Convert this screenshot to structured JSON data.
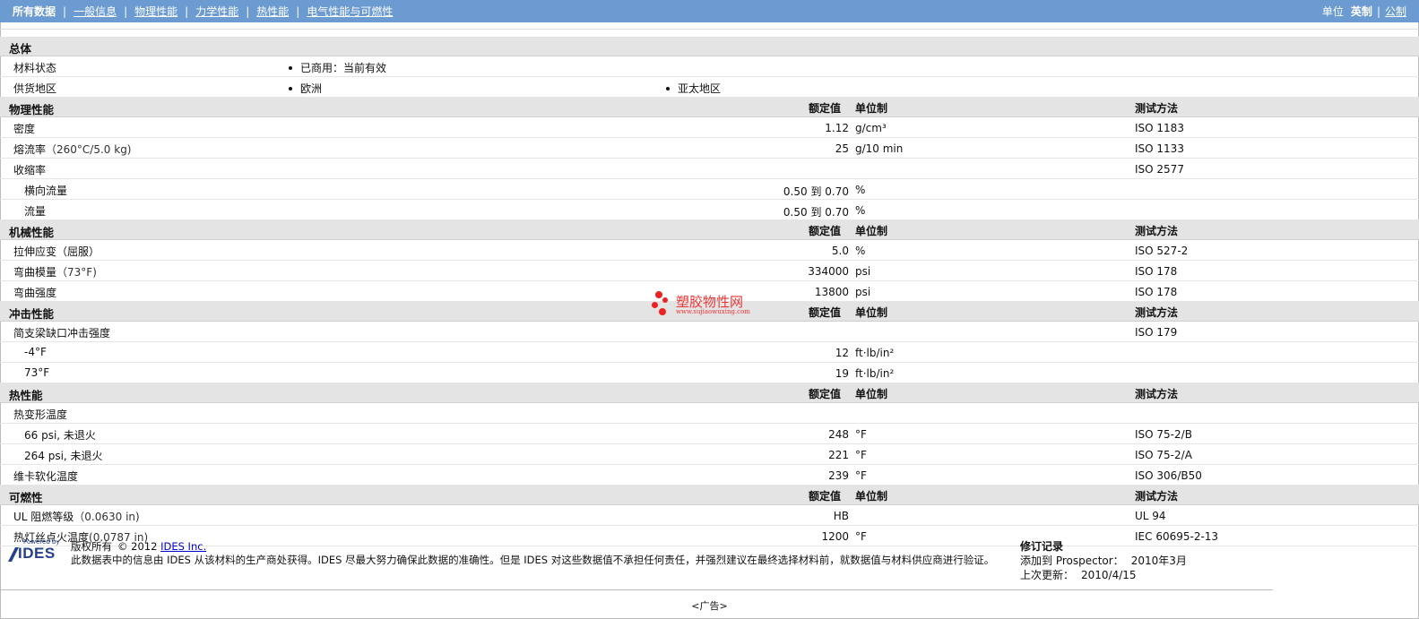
{
  "nav": {
    "tabs": [
      "所有数据",
      "一般信息",
      "物理性能",
      "力学性能",
      "热性能",
      "电气性能与可燃性"
    ],
    "units_label": "单位",
    "unit_english": "英制",
    "unit_metric": "公制"
  },
  "general": {
    "title": "总体",
    "material_status_label": "材料状态",
    "material_status_value": "已商用：当前有效",
    "availability_label": "供货地区",
    "availability_values": [
      "欧洲",
      "亚太地区"
    ]
  },
  "headers": {
    "nominal": "额定值",
    "unit": "单位制",
    "test": "测试方法"
  },
  "sections": [
    {
      "title": "物理性能",
      "rows": [
        {
          "name": "密度",
          "cond": "",
          "value": "1.12",
          "unit": "g/cm³",
          "test": "ISO 1183",
          "sub": false
        },
        {
          "name": "熔流率",
          "cond": "（260°C/5.0 kg)",
          "value": "25",
          "unit": "g/10 min",
          "test": "ISO 1133",
          "sub": false
        },
        {
          "name": "收缩率",
          "cond": "",
          "value": "",
          "unit": "",
          "test": "ISO 2577",
          "sub": false
        },
        {
          "name": "横向流量",
          "cond": "",
          "value": "0.50 到  0.70",
          "unit": "%",
          "test": "",
          "sub": true
        },
        {
          "name": "流量",
          "cond": "",
          "value": "0.50 到  0.70",
          "unit": "%",
          "test": "",
          "sub": true
        }
      ]
    },
    {
      "title": "机械性能",
      "rows": [
        {
          "name": "拉伸应变（屈服）",
          "cond": "",
          "value": "5.0",
          "unit": "%",
          "test": "ISO 527-2",
          "sub": false
        },
        {
          "name": "弯曲模量",
          "cond": "（73°F)",
          "value": "334000",
          "unit": "psi",
          "test": "ISO 178",
          "sub": false
        },
        {
          "name": "弯曲强度",
          "cond": "",
          "value": "13800",
          "unit": "psi",
          "test": "ISO 178",
          "sub": false
        }
      ]
    },
    {
      "title": "冲击性能",
      "rows": [
        {
          "name": "简支梁缺口冲击强度",
          "cond": "",
          "value": "",
          "unit": "",
          "test": "ISO 179",
          "sub": false
        },
        {
          "name": "-4°F",
          "cond": "",
          "value": "12",
          "unit": "ft·lb/in²",
          "test": "",
          "sub": true
        },
        {
          "name": "73°F",
          "cond": "",
          "value": "19",
          "unit": "ft·lb/in²",
          "test": "",
          "sub": true
        }
      ]
    },
    {
      "title": "热性能",
      "rows": [
        {
          "name": "热变形温度",
          "cond": "",
          "value": "",
          "unit": "",
          "test": "",
          "sub": false
        },
        {
          "name": "66 psi, 未退火",
          "cond": "",
          "value": "248",
          "unit": "°F",
          "test": "ISO 75-2/B",
          "sub": true
        },
        {
          "name": "264 psi, 未退火",
          "cond": "",
          "value": "221",
          "unit": "°F",
          "test": "ISO 75-2/A",
          "sub": true
        },
        {
          "name": "维卡软化温度",
          "cond": "",
          "value": "239",
          "unit": "°F",
          "test": "ISO 306/B50",
          "sub": false
        }
      ]
    },
    {
      "title": "可燃性",
      "rows": [
        {
          "name": "UL 阻燃等级",
          "cond": "（0.0630 in)",
          "value": "HB",
          "unit": "",
          "test": "UL 94",
          "sub": false
        },
        {
          "name": "热灯丝点火温度",
          "cond": "(0.0787 in)",
          "value": "1200",
          "unit": "°F",
          "test": "IEC 60695-2-13",
          "sub": false
        }
      ]
    }
  ],
  "watermark": {
    "title": "塑胶物性网",
    "url": "www.sujiaowuxing.com"
  },
  "footer": {
    "logo_powered": "Powered by",
    "logo_text": "IDES",
    "copyright": "版权所有",
    "year": "© 2012",
    "company_link": "IDES Inc.",
    "disclaimer": "此数据表中的信息由  IDES 从该材料的生产商处获得。IDES 尽最大努力确保此数据的准确性。但是  IDES 对这些数据值不承担任何责任，并强烈建议在最终选择材料前，就数据值与材料供应商进行验证。",
    "revision_title": "修订记录",
    "added_label": "添加到  Prospector：",
    "added_value": "2010年3月",
    "updated_label": "上次更新：",
    "updated_value": "2010/4/15"
  },
  "ad": "<广告>"
}
